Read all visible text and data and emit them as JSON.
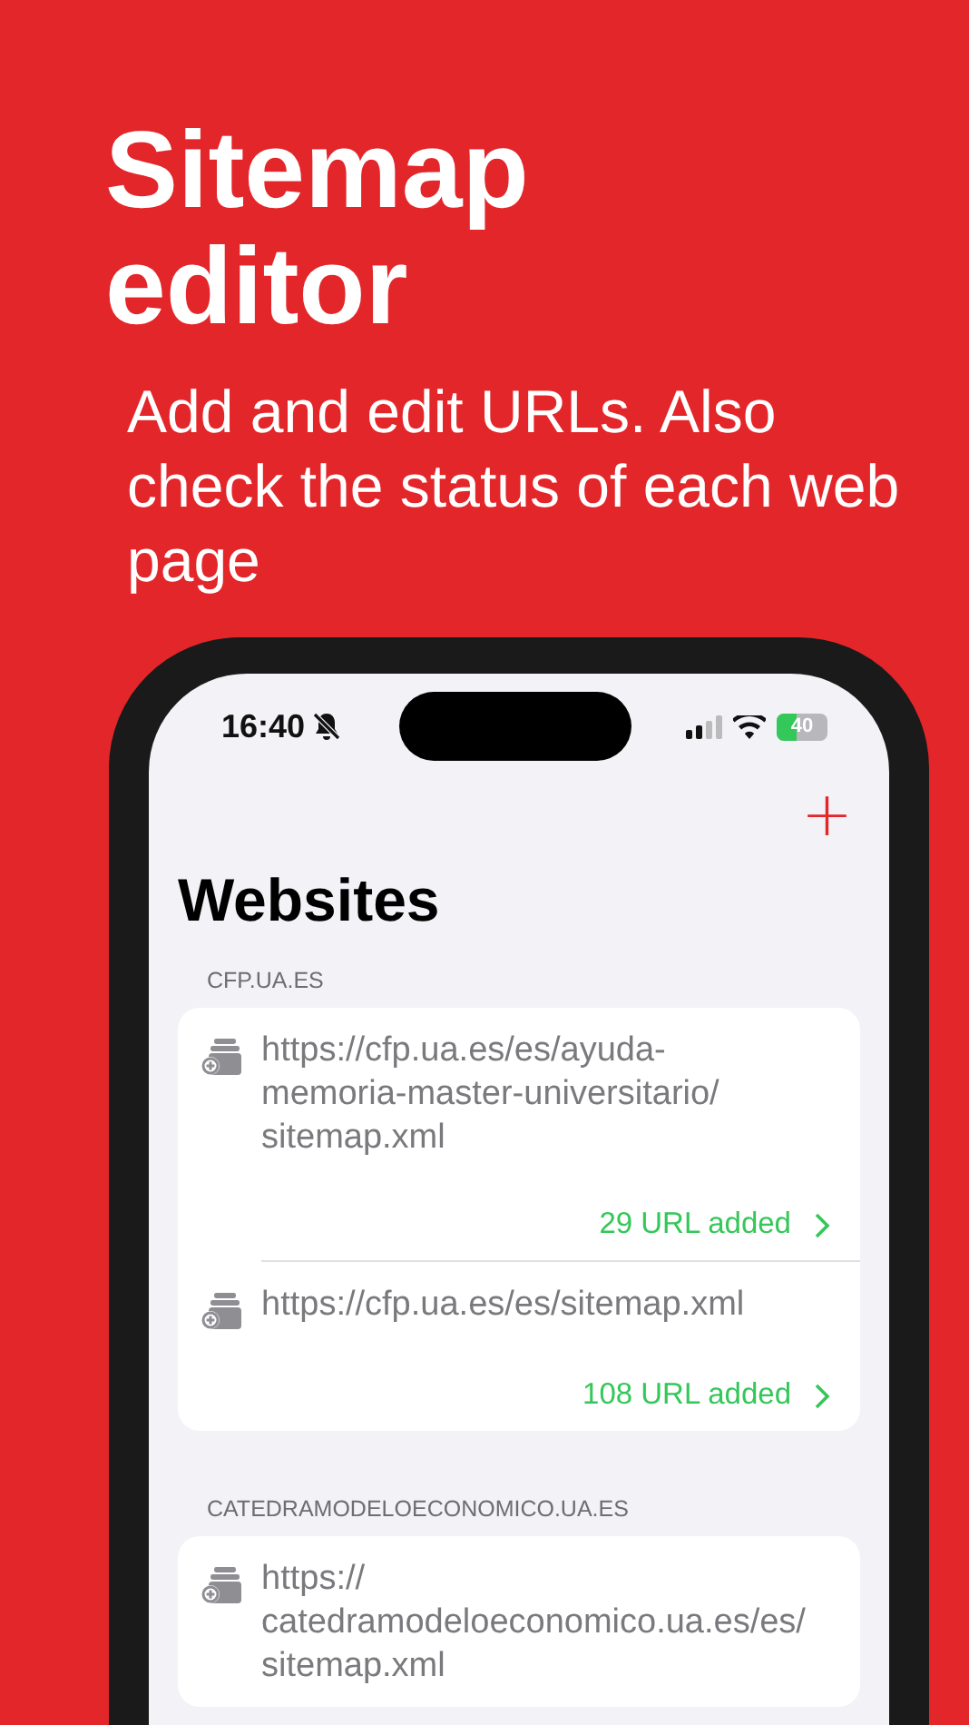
{
  "headline": "Sitemap editor",
  "subtitle": "Add and edit URLs. Also check the status of each web page",
  "status_bar": {
    "time": "16:40",
    "silent": true,
    "battery": "40"
  },
  "nav": {
    "add": "+",
    "title": "Websites"
  },
  "sections": [
    {
      "header": "CFP.UA.ES",
      "items": [
        {
          "url": "https://cfp.ua.es/es/ayuda-memoria-master-universitario/sitemap.xml",
          "count": "29 URL added"
        },
        {
          "url": "https://cfp.ua.es/es/sitemap.xml",
          "count": "108 URL added"
        }
      ]
    },
    {
      "header": "CATEDRAMODELOECONOMICO.UA.ES",
      "items": [
        {
          "url": "https://catedramodeloeconomico.ua.es/es/sitemap.xml"
        }
      ]
    }
  ]
}
